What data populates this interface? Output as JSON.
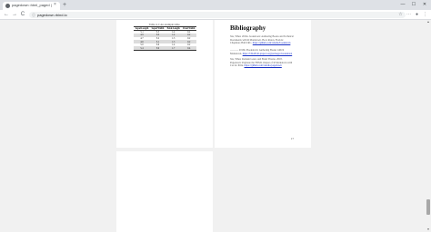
{
  "browser": {
    "tab": {
      "title": "pagedown::html_paged | R Markdown Paged HTML",
      "close_icon": "close-icon",
      "favicon": "page-icon"
    },
    "new_tab_glyph": "+",
    "window_controls": [
      "—",
      "☐",
      "✕"
    ],
    "nav": {
      "back": "←",
      "forward": "→",
      "reload": "C"
    },
    "address": {
      "lock_glyph": "ⓘ",
      "url": "pagedown.rbind.io"
    },
    "toolbar_glyphs": {
      "star": "☆",
      "extensions": "⋯",
      "profile": "●",
      "menu": "⋮"
    }
  },
  "table_page": {
    "caption": "Table 4.1: An example table.",
    "columns": [
      "Sepal.Length",
      "Sepal.Width",
      "Petal.Length",
      "Petal.Width"
    ],
    "rows": [
      [
        "5.1",
        "3.5",
        "1.4",
        "0.2"
      ],
      [
        "4.9",
        "3.0",
        "1.4",
        "0.2"
      ],
      [
        "4.7",
        "3.2",
        "1.3",
        "0.2"
      ],
      [
        "4.6",
        "3.1",
        "1.5",
        "0.2"
      ],
      [
        "5.0",
        "3.6",
        "1.4",
        "0.2"
      ],
      [
        "5.4",
        "3.9",
        "1.7",
        "0.4"
      ]
    ]
  },
  "bibliography_page": {
    "heading": "Bibliography",
    "entries": [
      {
        "text": "Xie, Yihui. 2016a. bookdown: Authoring Books and Technical Documents with R Markdown. Boca Raton, Florida: Chapman; Hall/CRC.",
        "link": "https://github.com/rstudio/bookdown"
      },
      {
        "text": "———. 2016b. Bookdown: Authoring Books with R Markdown.",
        "link": "https://CRAN.R-project.org/package=bookdown"
      },
      {
        "text": "Xie, Yihui, Romain Lesur, and Brent Thorne. 2018. Pagedown: Paginate the HTML Output of R Markdown with Css for Print.",
        "link": "https://github.com/rstudio/pagedown"
      }
    ],
    "folio": "17"
  },
  "scrollbar": {
    "up_glyph": "▲",
    "down_glyph": "▼",
    "position": 0.93
  }
}
